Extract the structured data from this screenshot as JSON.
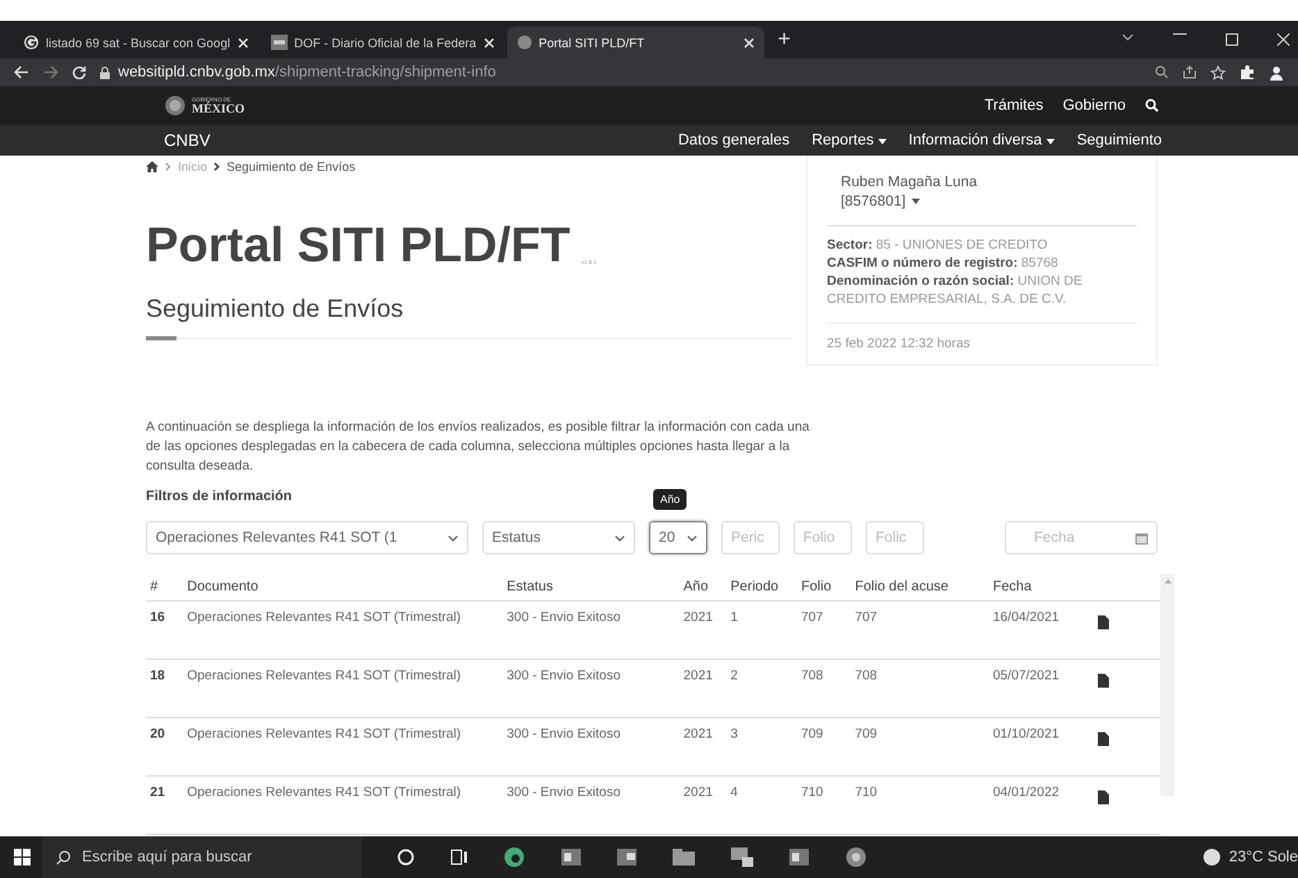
{
  "browser": {
    "tabs": [
      {
        "title": "listado 69 sat - Buscar con Googl",
        "selected": false
      },
      {
        "title": "DOF - Diario Oficial de la Federa",
        "selected": false
      },
      {
        "title": "Portal SITI PLD/FT",
        "selected": true
      }
    ],
    "new_tab": "+",
    "address": {
      "domain": "websitipld.cnbv.gob.mx",
      "path": "/shipment-tracking/shipment-info"
    }
  },
  "gov_header": {
    "logo_top": "GOBIERNO DE",
    "logo_main": "MÉXICO",
    "links": [
      "Trámites",
      "Gobierno"
    ]
  },
  "nav": {
    "brand": "CNBV",
    "items": [
      {
        "label": "Datos generales",
        "caret": false
      },
      {
        "label": "Reportes",
        "caret": true
      },
      {
        "label": "Información diversa",
        "caret": true
      },
      {
        "label": "Seguimiento",
        "caret": false
      }
    ]
  },
  "breadcrumb": [
    "Inicio",
    "Seguimiento de Envíos"
  ],
  "title": "Portal SITI PLD/FT",
  "version": "v1.8.1",
  "subtitle": "Seguimiento de Envíos",
  "user_card": {
    "name": "Ruben Magaña Luna",
    "id": "[8576801]",
    "info": [
      "**Sector:** 85 - UNIONES DE CREDITO",
      "**CASFIM o número de registro:** 85768",
      "**Denominación o razón social:** UNION DE CREDITO EMPRESARIAL, S.A. DE C.V."
    ],
    "date": "25 feb 2022 12:32 horas"
  },
  "description": "A continuación se despliega la información de los envíos realizados, es posible filtrar la información con cada una de las opciones desplegadas en la cabecera de cada columna, selecciona múltiples opciones hasta llegar a la consulta deseada.",
  "filters": {
    "label": "Filtros de información",
    "fields": [
      {
        "kind": "select",
        "value": "Operaciones Relevantes R41 SOT (1",
        "focused": false
      },
      {
        "kind": "select",
        "value": "Estatus",
        "focused": false
      },
      {
        "kind": "select",
        "value": "20",
        "focused": true,
        "tooltip": "Año"
      },
      {
        "kind": "input",
        "placeholder": "Peric",
        "focused": false
      },
      {
        "kind": "input",
        "placeholder": "Folio",
        "focused": false
      },
      {
        "kind": "input",
        "placeholder": "Folic",
        "focused": false
      },
      {
        "kind": "date",
        "placeholder": "Fecha",
        "focused": false
      }
    ]
  },
  "table": {
    "columns": [
      "#",
      "Documento",
      "Estatus",
      "Año",
      "Periodo",
      "Folio",
      "Folio del acuse",
      "Fecha"
    ],
    "rows": [
      {
        "cells": [
          "16",
          "Operaciones Relevantes R41 SOT (Trimestral)",
          "300 - Envio Exitoso",
          "2021",
          "1",
          "707",
          "707",
          "16/04/2021"
        ]
      },
      {
        "cells": [
          "18",
          "Operaciones Relevantes R41 SOT (Trimestral)",
          "300 - Envio Exitoso",
          "2021",
          "2",
          "708",
          "708",
          "05/07/2021"
        ]
      },
      {
        "cells": [
          "20",
          "Operaciones Relevantes R41 SOT (Trimestral)",
          "300 - Envio Exitoso",
          "2021",
          "3",
          "709",
          "709",
          "01/10/2021"
        ]
      },
      {
        "cells": [
          "21",
          "Operaciones Relevantes R41 SOT (Trimestral)",
          "300 - Envio Exitoso",
          "2021",
          "4",
          "710",
          "710",
          "04/01/2022"
        ]
      }
    ]
  },
  "taskbar": {
    "search_placeholder": "Escribe aquí para buscar",
    "weather": "23°C Sole"
  }
}
